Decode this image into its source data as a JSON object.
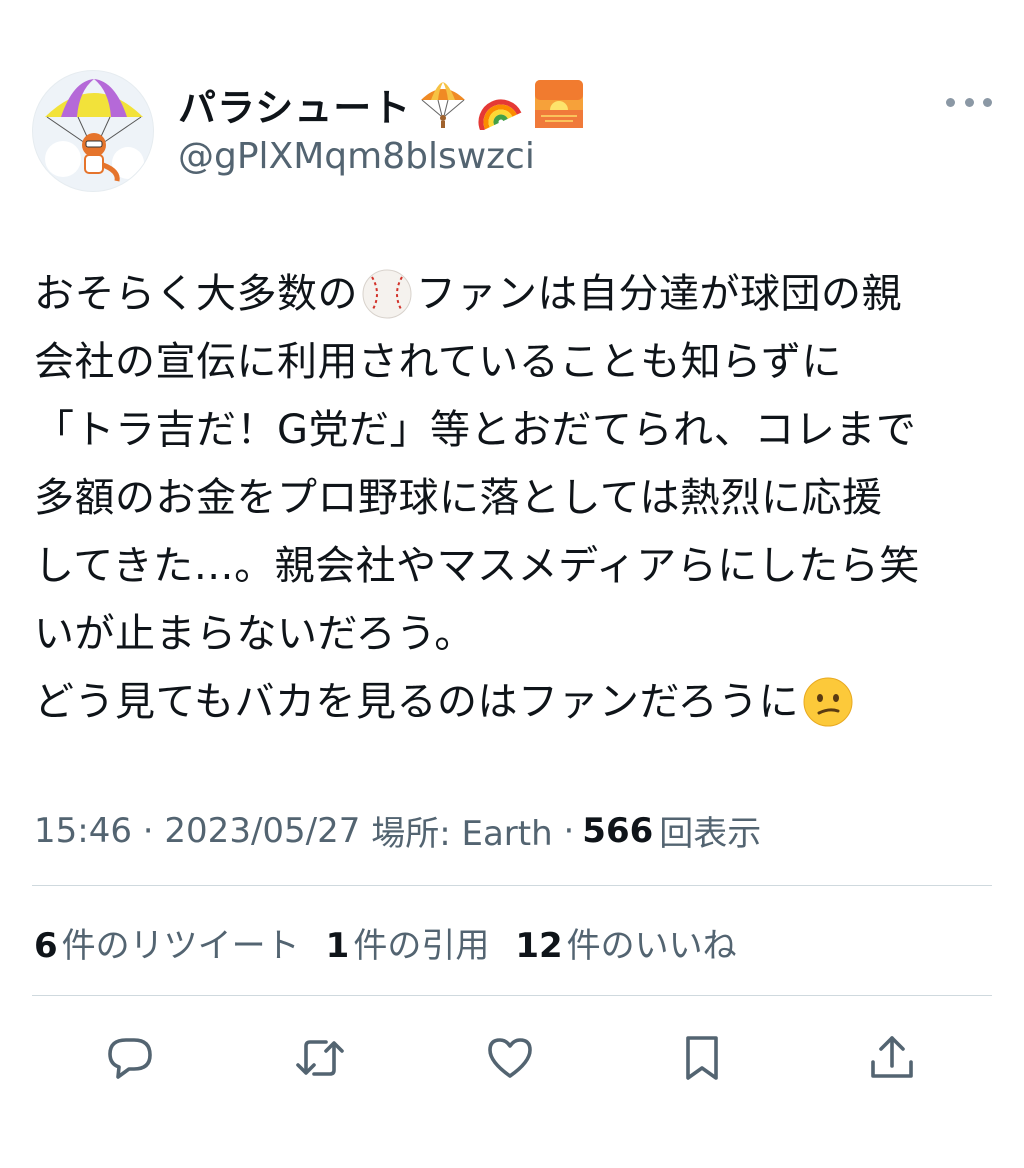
{
  "user": {
    "display_name": "パラシュート",
    "name_emojis": [
      "parachute-emoji",
      "rainbow-emoji",
      "sunrise-emoji"
    ],
    "handle": "@gPlXMqm8blswzci"
  },
  "tweet": {
    "lines": [
      [
        "おそらく大多数の",
        "{baseball}",
        "ファンは自分達が球団の親"
      ],
      [
        "会社の宣伝に利用されていることも知らずに"
      ],
      [
        "「トラ吉だ！G党だ」等とおだてられ、コレまで"
      ],
      [
        "多額のお金をプロ野球に落としては熱烈に応援"
      ],
      [
        "してきた…。親会社やマスメディアらにしたら笑"
      ],
      [
        "いが止まらないだろう。"
      ],
      [
        "どう見てもバカを見るのはファンだろうに",
        "{confused}"
      ]
    ]
  },
  "meta": {
    "time": "15:46",
    "date": "2023/05/27",
    "location": "場所: Earth",
    "views_count": "566",
    "views_label": "回表示"
  },
  "stats": {
    "retweets_count": "6",
    "retweets_label": "件のリツイート",
    "quotes_count": "1",
    "quotes_label": "件の引用",
    "likes_count": "12",
    "likes_label": "件のいいね"
  },
  "actions": [
    "reply-icon",
    "retweet-icon",
    "like-icon",
    "bookmark-icon",
    "share-icon"
  ],
  "colors": {
    "secondary": "#536471",
    "primary": "#0f1419",
    "divider": "#cfd9de"
  }
}
